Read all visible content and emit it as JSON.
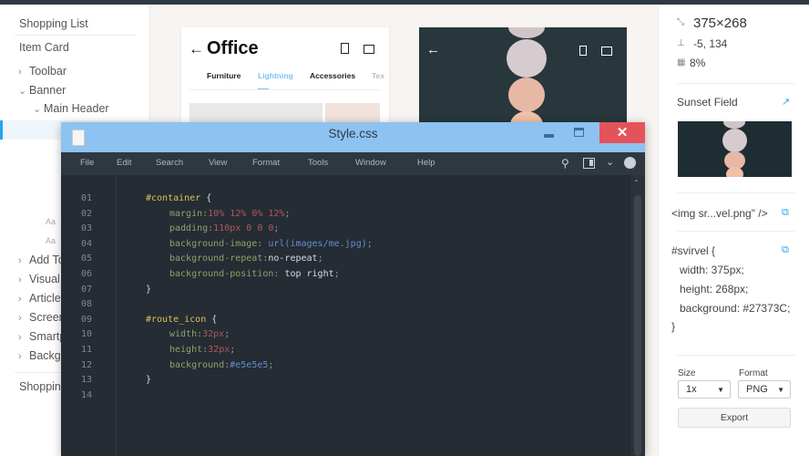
{
  "sidebar": {
    "items": [
      "Shopping List",
      "Item Card",
      "Toolbar",
      "Banner",
      "Main Header",
      "Add To",
      "Visual",
      "Article",
      "Screen",
      "Smartp",
      "Backg",
      "Shopping"
    ],
    "aa": [
      "Aa",
      "Aa"
    ]
  },
  "card": {
    "title": "Office",
    "tabs": [
      "Furniture",
      "Lightning",
      "Accessories",
      "Tex"
    ]
  },
  "editor": {
    "title": "Style.css",
    "menu": [
      "File",
      "Edit",
      "Search",
      "View",
      "Format",
      "Tools",
      "Window",
      "Help"
    ],
    "lines": [
      "01",
      "02",
      "03",
      "04",
      "05",
      "06",
      "07",
      "08",
      "09",
      "10",
      "11",
      "12",
      "13",
      "14"
    ]
  },
  "right": {
    "size": "375×268",
    "position": "-5, 134",
    "opacity": "8%",
    "asset_name": "Sunset Field",
    "img_tag": "<img sr...vel.png\" />",
    "css": [
      "#svirvel {",
      "width: 375px;",
      "height: 268px;",
      "background: #27373C;",
      "}"
    ],
    "size_label": "Size",
    "size_value": "1x",
    "format_label": "Format",
    "format_value": "PNG",
    "export": "Export"
  },
  "colors": {
    "accent": "#1ea7f0",
    "titlebar": "#8dc2f1",
    "close": "#e5535a"
  }
}
